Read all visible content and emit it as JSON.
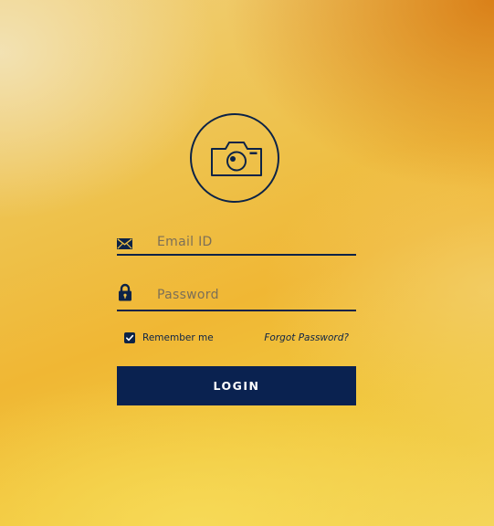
{
  "colors": {
    "primary": "#0c2347",
    "button_bg": "#0a2250",
    "button_text": "#ffffff",
    "background_top_right": "#d6740e",
    "background_main": "#eec14a"
  },
  "icons": {
    "avatar": "camera-icon",
    "email": "envelope-icon",
    "password": "lock-icon",
    "remember": "check-icon"
  },
  "login_form": {
    "email": {
      "placeholder": "Email ID",
      "value": ""
    },
    "password": {
      "placeholder": "Password",
      "value": ""
    },
    "remember_me": {
      "label": "Remember me",
      "checked": true
    },
    "forgot_password_label": "Forgot Password?",
    "login_label": "LOGIN"
  }
}
